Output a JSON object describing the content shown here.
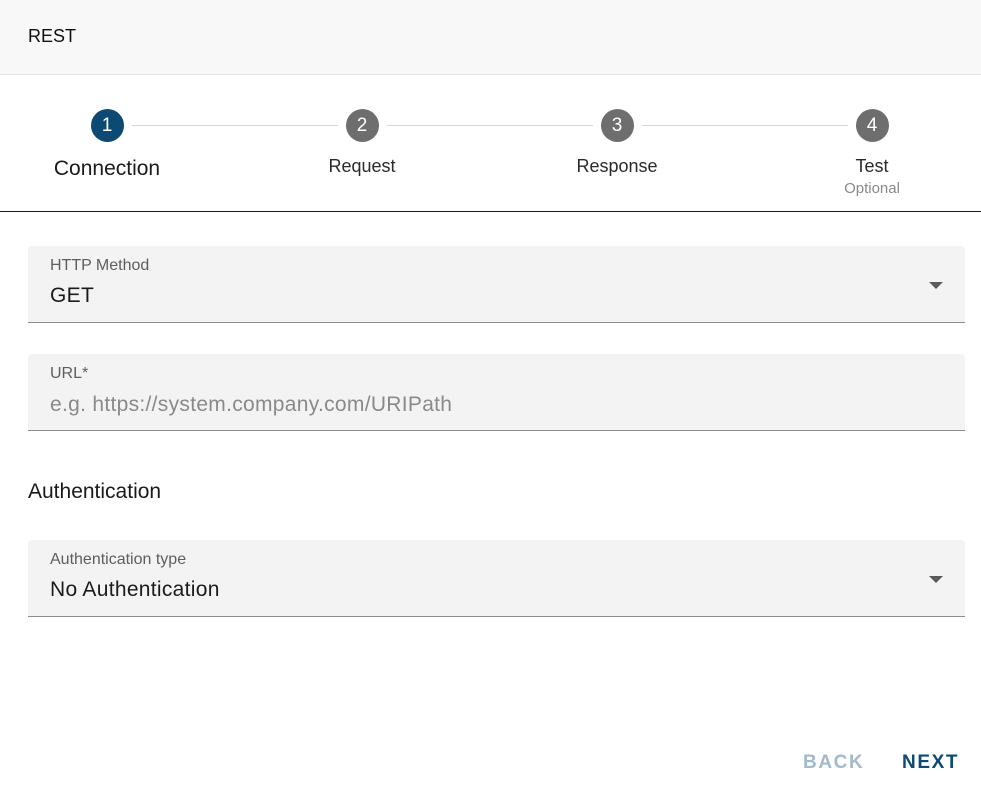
{
  "header": {
    "title": "REST"
  },
  "stepper": {
    "steps": [
      {
        "number": "1",
        "label": "Connection",
        "sublabel": "",
        "state": "active"
      },
      {
        "number": "2",
        "label": "Request",
        "sublabel": "",
        "state": "inactive"
      },
      {
        "number": "3",
        "label": "Response",
        "sublabel": "",
        "state": "inactive"
      },
      {
        "number": "4",
        "label": "Test",
        "sublabel": "Optional",
        "state": "inactive"
      }
    ]
  },
  "form": {
    "http_method": {
      "label": "HTTP Method",
      "value": "GET"
    },
    "url": {
      "label": "URL*",
      "value": "",
      "placeholder": "e.g. https://system.company.com/URIPath"
    },
    "authentication": {
      "section_title": "Authentication",
      "type": {
        "label": "Authentication type",
        "value": "No Authentication"
      }
    }
  },
  "footer": {
    "back_label": "BACK",
    "next_label": "NEXT"
  },
  "colors": {
    "accent": "#0d4a73",
    "step_inactive": "#6e6e6e",
    "button_disabled": "#a3b9cc",
    "field_background": "#f3f3f3"
  }
}
